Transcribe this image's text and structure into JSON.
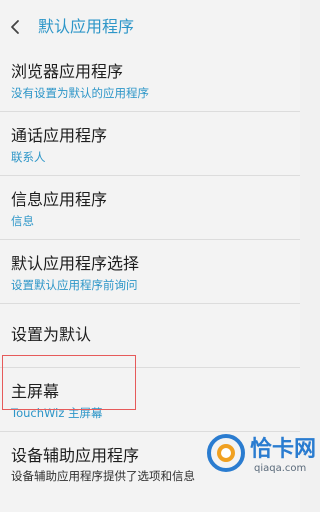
{
  "header": {
    "title": "默认应用程序",
    "back_icon": "chevron-left-icon"
  },
  "items": [
    {
      "title": "浏览器应用程序",
      "subtitle": "没有设置为默认的应用程序"
    },
    {
      "title": "通话应用程序",
      "subtitle": "联系人"
    },
    {
      "title": "信息应用程序",
      "subtitle": "信息"
    },
    {
      "title": "默认应用程序选择",
      "subtitle": "设置默认应用程序前询问"
    },
    {
      "title": "设置为默认",
      "subtitle": ""
    },
    {
      "title": "主屏幕",
      "subtitle": "TouchWiz 主屏幕"
    },
    {
      "title": "设备辅助应用程序",
      "subtitle": "设备辅助应用程序提供了选项和信息"
    }
  ],
  "colors": {
    "accent": "#2d96c8",
    "highlight_border": "#e65a5a",
    "background": "#f3f3f3"
  },
  "watermark": {
    "name": "恰卡网",
    "domain": "qiaqa.com"
  }
}
